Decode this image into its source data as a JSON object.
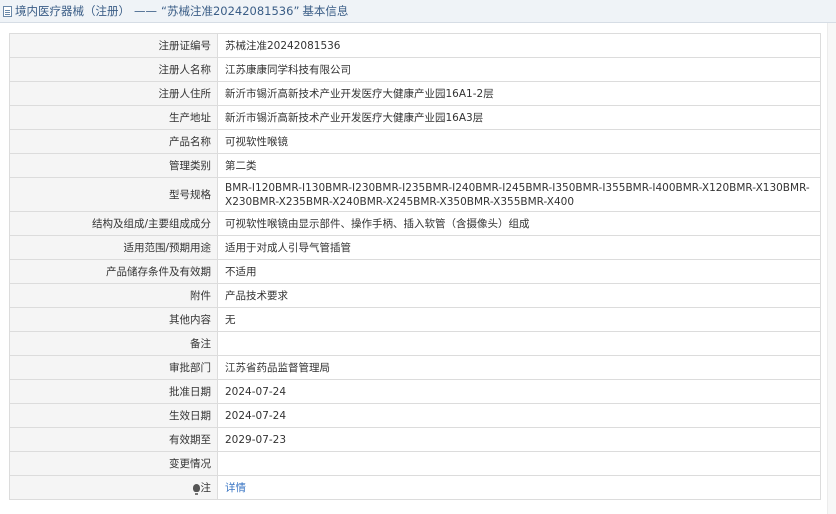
{
  "header": {
    "category": "境内医疗器械（注册）",
    "separator": "——",
    "product_ref": "“苏械注准20242081536”",
    "suffix": "基本信息"
  },
  "rows": [
    {
      "label": "注册证编号",
      "value": "苏械注准20242081536"
    },
    {
      "label": "注册人名称",
      "value": "江苏康康同学科技有限公司"
    },
    {
      "label": "注册人住所",
      "value": "新沂市锡沂高新技术产业开发医疗大健康产业园16A1-2层"
    },
    {
      "label": "生产地址",
      "value": "新沂市锡沂高新技术产业开发医疗大健康产业园16A3层"
    },
    {
      "label": "产品名称",
      "value": "可视软性喉镜"
    },
    {
      "label": "管理类别",
      "value": "第二类"
    },
    {
      "label": "型号规格",
      "value": "BMR-I120BMR-I130BMR-I230BMR-I235BMR-I240BMR-I245BMR-I350BMR-I355BMR-I400BMR-X120BMR-X130BMR-X230BMR-X235BMR-X240BMR-X245BMR-X350BMR-X355BMR-X400"
    },
    {
      "label": "结构及组成/主要组成成分",
      "value": "可视软性喉镜由显示部件、操作手柄、插入软管（含摄像头）组成"
    },
    {
      "label": "适用范围/预期用途",
      "value": "适用于对成人引导气管插管"
    },
    {
      "label": "产品储存条件及有效期",
      "value": "不适用"
    },
    {
      "label": "附件",
      "value": "产品技术要求"
    },
    {
      "label": "其他内容",
      "value": "无"
    },
    {
      "label": "备注",
      "value": ""
    },
    {
      "label": "审批部门",
      "value": "江苏省药品监督管理局"
    },
    {
      "label": "批准日期",
      "value": "2024-07-24"
    },
    {
      "label": "生效日期",
      "value": "2024-07-24"
    },
    {
      "label": "有效期至",
      "value": "2029-07-23"
    },
    {
      "label": "变更情况",
      "value": ""
    }
  ],
  "note_row": {
    "label": "注",
    "value": "详情",
    "icon": "lightbulb-icon"
  }
}
